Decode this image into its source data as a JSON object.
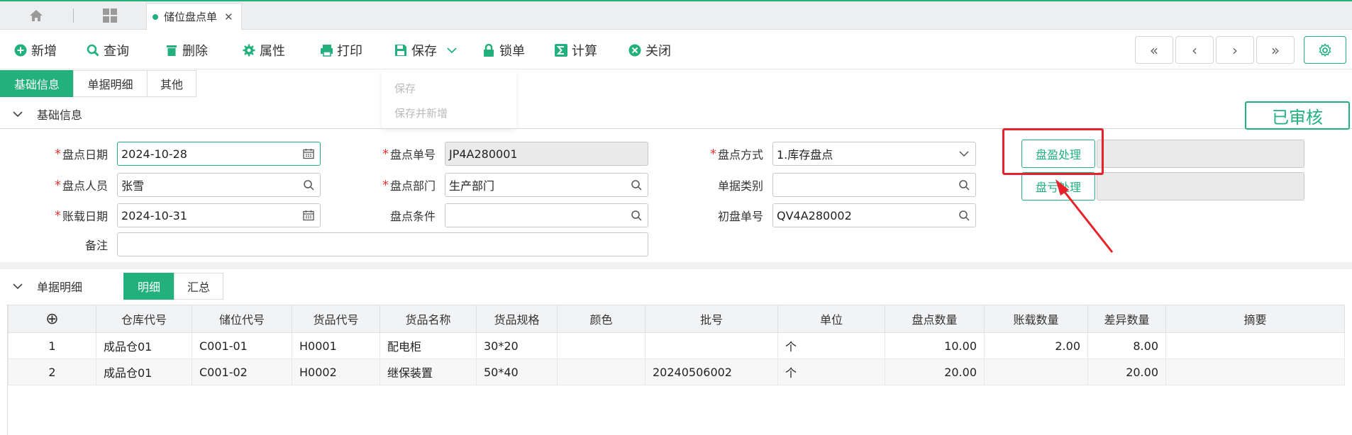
{
  "tabbar": {
    "doc_tab_label": "储位盘点单"
  },
  "toolbar": {
    "new": "新增",
    "query": "查询",
    "delete": "删除",
    "props": "属性",
    "print": "打印",
    "save": "保存",
    "lock": "锁单",
    "calc": "计算",
    "close": "关闭"
  },
  "nav": {
    "first": "«",
    "prev": "‹",
    "next": "›",
    "last": "»"
  },
  "subtabs": [
    "基础信息",
    "单据明细",
    "其他"
  ],
  "save_menu": [
    "保存",
    "保存并新增"
  ],
  "basic": {
    "title": "基础信息",
    "status": "已审核",
    "labels": {
      "date": "盘点日期",
      "no": "盘点单号",
      "mode": "盘点方式",
      "person": "盘点人员",
      "dept": "盘点部门",
      "type": "单据类别",
      "acct_date": "账载日期",
      "cond": "盘点条件",
      "first_no": "初盘单号",
      "remark": "备注"
    },
    "values": {
      "date": "2024-10-28",
      "no": "JP4A280001",
      "mode": "1.库存盘点",
      "person": "张雪",
      "dept": "生产部门",
      "type": "",
      "acct_date": "2024-10-31",
      "cond": "",
      "first_no": "QV4A280002",
      "remark": ""
    },
    "btn_surplus": "盘盈处理",
    "btn_loss": "盘亏处理"
  },
  "detail": {
    "title": "单据明细",
    "tabs": [
      "明细",
      "汇总"
    ],
    "add_icon": "⊕",
    "columns": [
      "仓库代号",
      "储位代号",
      "货品代号",
      "货品名称",
      "货品规格",
      "颜色",
      "批号",
      "单位",
      "盘点数量",
      "账载数量",
      "差异数量",
      "摘要"
    ],
    "rows": [
      [
        "1",
        "成品仓01",
        "C001-01",
        "H0001",
        "配电柜",
        "30*20",
        "",
        "",
        "个",
        "10.00",
        "2.00",
        "8.00",
        ""
      ],
      [
        "2",
        "成品仓01",
        "C001-02",
        "H0002",
        "继保装置",
        "50*40",
        "",
        "20240506002",
        "个",
        "20.00",
        "",
        "20.00",
        ""
      ]
    ]
  },
  "colors": {
    "accent": "#22b07d",
    "highlight": "#e8212a"
  }
}
